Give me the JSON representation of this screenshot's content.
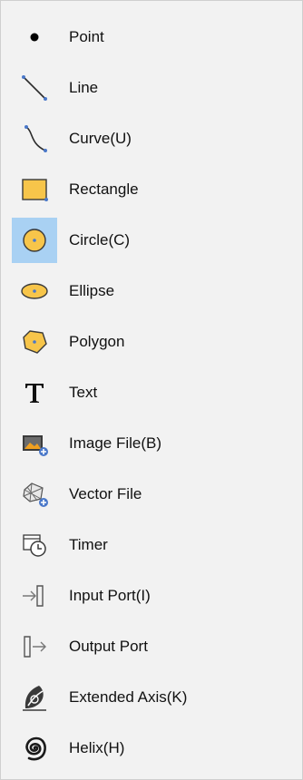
{
  "menu": {
    "items": [
      {
        "label": "Point",
        "icon": "point-icon"
      },
      {
        "label": "Line",
        "icon": "line-icon"
      },
      {
        "label": "Curve(U)",
        "icon": "curve-icon"
      },
      {
        "label": "Rectangle",
        "icon": "rectangle-icon"
      },
      {
        "label": "Circle(C)",
        "icon": "circle-icon",
        "highlighted": true
      },
      {
        "label": "Ellipse",
        "icon": "ellipse-icon"
      },
      {
        "label": "Polygon",
        "icon": "polygon-icon"
      },
      {
        "label": "Text",
        "icon": "text-icon"
      },
      {
        "label": "Image File(B)",
        "icon": "image-file-icon"
      },
      {
        "label": "Vector File",
        "icon": "vector-file-icon"
      },
      {
        "label": "Timer",
        "icon": "timer-icon"
      },
      {
        "label": "Input Port(I)",
        "icon": "input-port-icon"
      },
      {
        "label": "Output Port",
        "icon": "output-port-icon"
      },
      {
        "label": "Extended Axis(K)",
        "icon": "extended-axis-icon"
      },
      {
        "label": "Helix(H)",
        "icon": "helix-icon"
      }
    ]
  },
  "colors": {
    "menu_background": "#f2f2f2",
    "highlight": "#a9d1f3",
    "shape_fill": "#f7c54a",
    "handle_blue": "#4a78c9"
  }
}
